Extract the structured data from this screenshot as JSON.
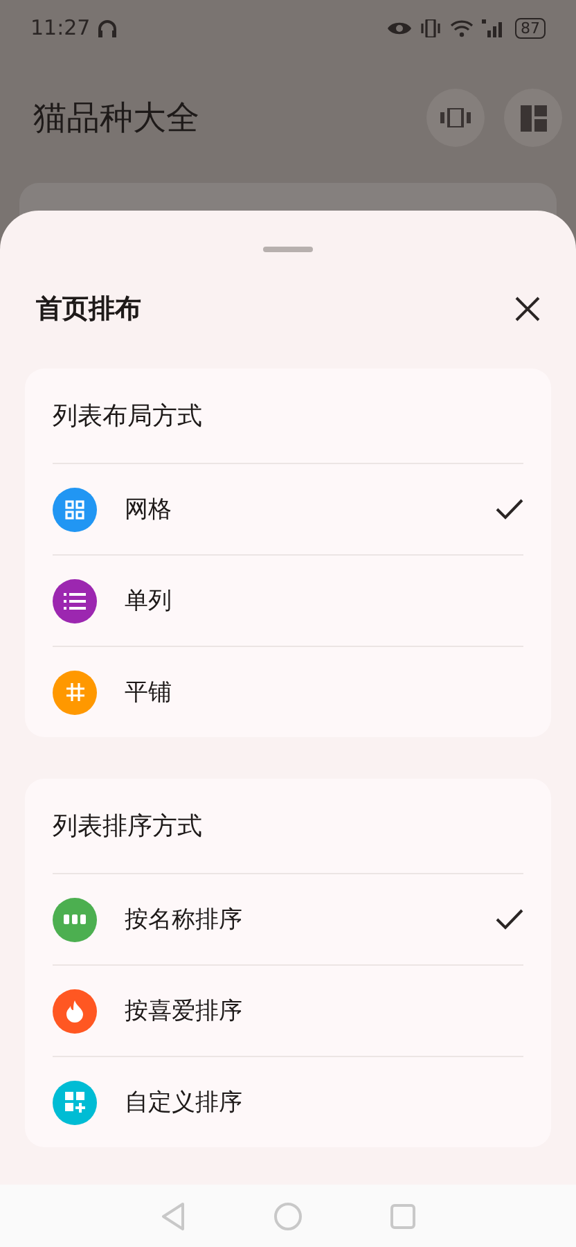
{
  "status_bar": {
    "time": "11:27",
    "battery": "87"
  },
  "page": {
    "title": "猫品种大全"
  },
  "sheet": {
    "title": "首页排布",
    "sections": [
      {
        "title": "列表布局方式",
        "options": [
          {
            "label": "网格",
            "color": "#2196f3",
            "selected": true
          },
          {
            "label": "单列",
            "color": "#9c27b0",
            "selected": false
          },
          {
            "label": "平铺",
            "color": "#ff9800",
            "selected": false
          }
        ]
      },
      {
        "title": "列表排序方式",
        "options": [
          {
            "label": "按名称排序",
            "color": "#4caf50",
            "selected": true
          },
          {
            "label": "按喜爱排序",
            "color": "#ff5722",
            "selected": false
          },
          {
            "label": "自定义排序",
            "color": "#00bcd4",
            "selected": false
          }
        ]
      }
    ]
  }
}
